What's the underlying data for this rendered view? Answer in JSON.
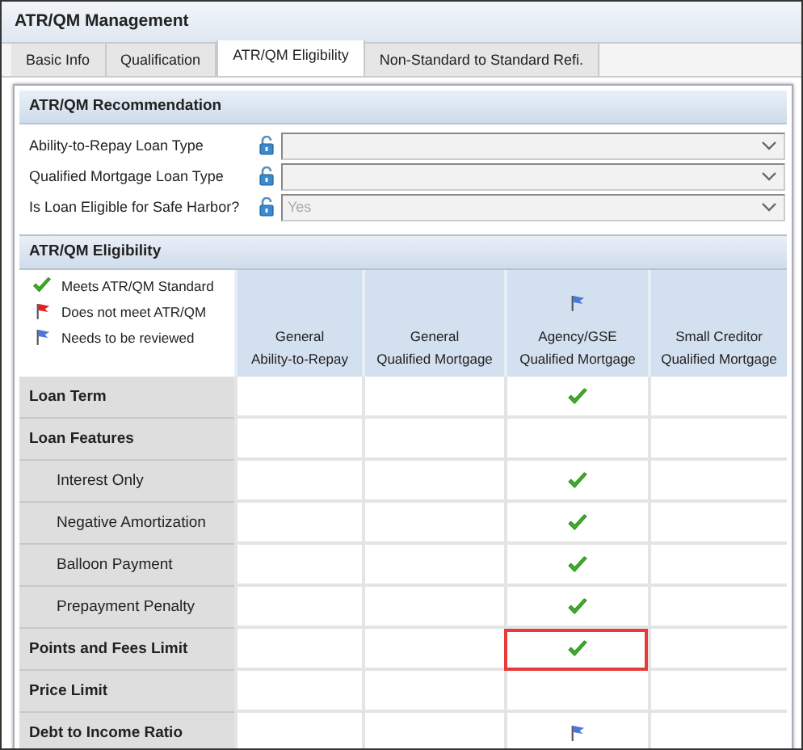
{
  "window": {
    "title": "ATR/QM Management"
  },
  "tabs": [
    {
      "label": "Basic Info",
      "selected": false
    },
    {
      "label": "Qualification",
      "selected": false
    },
    {
      "label": "ATR/QM Eligibility",
      "selected": true
    },
    {
      "label": "Non-Standard to Standard Refi.",
      "selected": false
    }
  ],
  "recommendation": {
    "title": "ATR/QM Recommendation",
    "fields": [
      {
        "label": "Ability-to-Repay Loan Type",
        "locked": true
      },
      {
        "label": "Qualified Mortgage Loan Type",
        "locked": true
      },
      {
        "label": "Is Loan Eligible for Safe Harbor?",
        "locked": true,
        "value": "Yes"
      }
    ]
  },
  "eligibility": {
    "title": "ATR/QM Eligibility",
    "legend": [
      {
        "kind": "check",
        "label": "Meets ATR/QM Standard"
      },
      {
        "kind": "red-flag",
        "label": "Does not meet ATR/QM"
      },
      {
        "kind": "blue-flag",
        "label": "Needs to be reviewed"
      }
    ],
    "columns": [
      {
        "line1": "General",
        "line2": "Ability-to-Repay"
      },
      {
        "line1": "General",
        "line2": "Qualified Mortgage"
      },
      {
        "line1": "Agency/GSE",
        "line2": "Qualified Mortgage",
        "kind": "blue-flag"
      },
      {
        "line1": "Small Creditor",
        "line2": "Qualified Mortgage"
      }
    ],
    "rows": [
      {
        "label": "Loan Term",
        "cells": [
          {
            "highlighted": false
          },
          {
            "highlighted": false
          },
          {
            "kind": "check",
            "highlighted": false
          },
          {
            "highlighted": false
          }
        ]
      },
      {
        "label": "Loan Features",
        "cells": [
          {
            "highlighted": false
          },
          {
            "highlighted": false
          },
          {
            "highlighted": false
          },
          {
            "highlighted": false
          }
        ],
        "children": [
          {
            "label": "Interest Only",
            "cells": [
              {
                "highlighted": false
              },
              {
                "highlighted": false
              },
              {
                "kind": "check",
                "highlighted": false
              },
              {
                "highlighted": false
              }
            ]
          },
          {
            "label": "Negative Amortization",
            "cells": [
              {
                "highlighted": false
              },
              {
                "highlighted": false
              },
              {
                "kind": "check",
                "highlighted": false
              },
              {
                "highlighted": false
              }
            ]
          },
          {
            "label": "Balloon Payment",
            "cells": [
              {
                "highlighted": false
              },
              {
                "highlighted": false
              },
              {
                "kind": "check",
                "highlighted": false
              },
              {
                "highlighted": false
              }
            ]
          },
          {
            "label": "Prepayment Penalty",
            "cells": [
              {
                "highlighted": false
              },
              {
                "highlighted": false
              },
              {
                "kind": "check",
                "highlighted": false
              },
              {
                "highlighted": false
              }
            ]
          }
        ]
      },
      {
        "label": "Points and Fees Limit",
        "cells": [
          {
            "highlighted": false
          },
          {
            "highlighted": false
          },
          {
            "kind": "check",
            "highlighted": true
          },
          {
            "highlighted": false
          }
        ]
      },
      {
        "label": "Price Limit",
        "cells": [
          {
            "highlighted": false
          },
          {
            "highlighted": false
          },
          {
            "highlighted": false
          },
          {
            "highlighted": false
          }
        ]
      },
      {
        "label": "Debt to Income Ratio",
        "cells": [
          {
            "highlighted": false
          },
          {
            "highlighted": false
          },
          {
            "kind": "blue-flag",
            "highlighted": false
          },
          {
            "highlighted": false
          }
        ]
      }
    ]
  }
}
